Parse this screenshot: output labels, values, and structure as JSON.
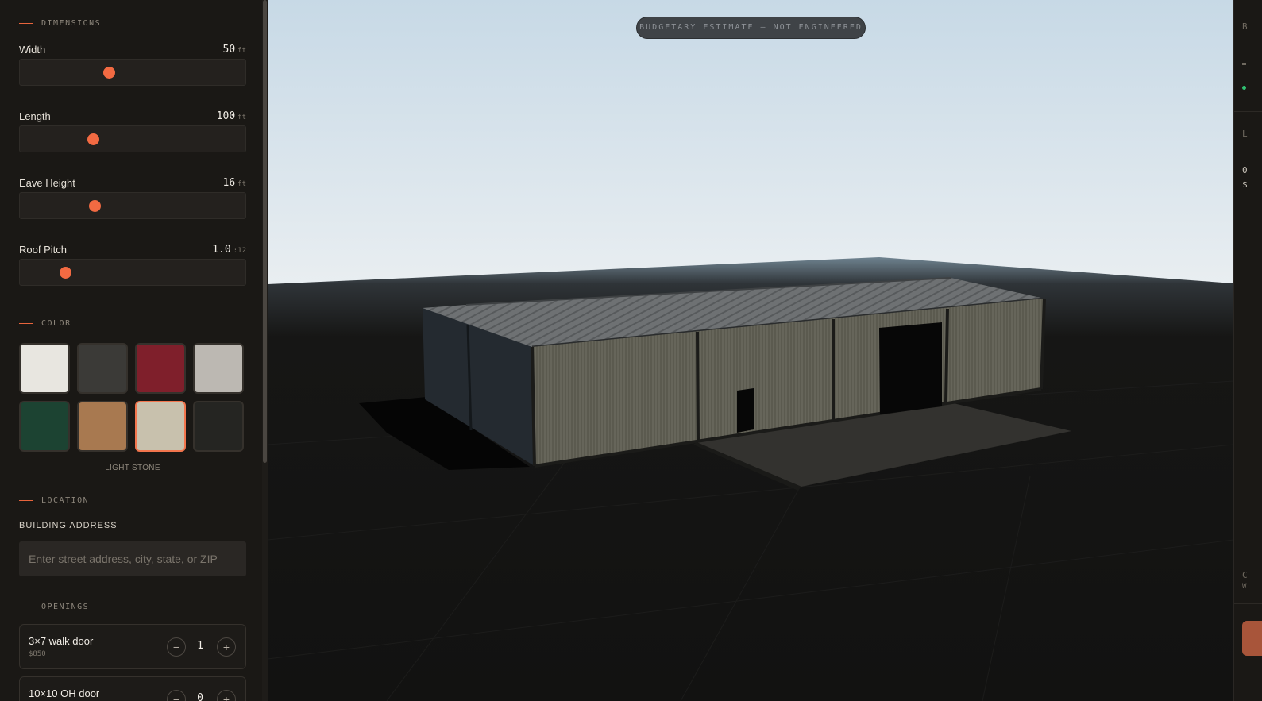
{
  "sidebar": {
    "sections": {
      "dimensions": "DIMENSIONS",
      "color": "COLOR",
      "location": "LOCATION",
      "openings": "OPENINGS"
    },
    "dimensions": [
      {
        "label": "Width",
        "value": "50",
        "unit": "ft",
        "slider_fraction": 0.39
      },
      {
        "label": "Length",
        "value": "100",
        "unit": "ft",
        "slider_fraction": 0.32
      },
      {
        "label": "Eave Height",
        "value": "16",
        "unit": "ft",
        "slider_fraction": 0.33
      },
      {
        "label": "Roof Pitch",
        "value": "1.0",
        "unit": ":12",
        "slider_fraction": 0.2
      }
    ],
    "colors": [
      {
        "name": "white",
        "hex": "#e8e6e0"
      },
      {
        "name": "charcoal",
        "hex": "#3b3a37"
      },
      {
        "name": "burgundy",
        "hex": "#7f1f2b"
      },
      {
        "name": "light gray",
        "hex": "#bcb8b2"
      },
      {
        "name": "forest green",
        "hex": "#1c4332"
      },
      {
        "name": "tan",
        "hex": "#a87950"
      },
      {
        "name": "light stone",
        "hex": "#c8c1ad",
        "selected": true
      },
      {
        "name": "black",
        "hex": "#252522"
      }
    ],
    "selected_color_label": "LIGHT STONE",
    "location": {
      "address_label": "BUILDING ADDRESS",
      "address_placeholder": "Enter street address, city, state, or ZIP",
      "address_value": ""
    },
    "openings": [
      {
        "name": "3×7 walk door",
        "price": "$850",
        "count": "1"
      },
      {
        "name": "10×10 OH door",
        "price": "",
        "count": "0"
      }
    ],
    "stepper": {
      "minus": "−",
      "plus": "+"
    }
  },
  "viewport": {
    "badge": "BUDGETARY ESTIMATE — NOT ENGINEERED"
  },
  "right_panel": {
    "fragments": [
      "B",
      "L",
      "0",
      "$",
      "C",
      "W"
    ]
  },
  "theme": {
    "accent": "#f26a42",
    "background": "#141210",
    "panel": "#1a1815"
  }
}
